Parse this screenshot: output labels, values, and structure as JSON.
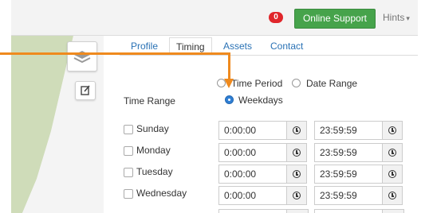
{
  "header": {
    "notification_count": "0",
    "support_label": "Online Support",
    "hints_label": "Hints",
    "hints_caret": "▾"
  },
  "tabs": [
    {
      "label": "Profile",
      "active": false
    },
    {
      "label": "Timing",
      "active": true
    },
    {
      "label": "Assets",
      "active": false
    },
    {
      "label": "Contact",
      "active": false
    }
  ],
  "timing": {
    "time_range_label": "Time Range",
    "options": [
      {
        "label": "Time Period",
        "checked": false
      },
      {
        "label": "Date Range",
        "checked": false
      },
      {
        "label": "Weekdays",
        "checked": true
      }
    ],
    "days": [
      {
        "name": "Sunday",
        "checked": false,
        "start": "0:00:00",
        "end": "23:59:59"
      },
      {
        "name": "Monday",
        "checked": false,
        "start": "0:00:00",
        "end": "23:59:59"
      },
      {
        "name": "Tuesday",
        "checked": false,
        "start": "0:00:00",
        "end": "23:59:59"
      },
      {
        "name": "Wednesday",
        "checked": false,
        "start": "0:00:00",
        "end": "23:59:59"
      }
    ]
  },
  "colors": {
    "accent_green": "#46a34b",
    "badge_red": "#e0262b",
    "link_blue": "#2a72b5",
    "annotation_orange": "#ef8a1e"
  },
  "icons": [
    "layers-icon",
    "edit-icon",
    "clock-icon",
    "chevron-down-icon"
  ]
}
